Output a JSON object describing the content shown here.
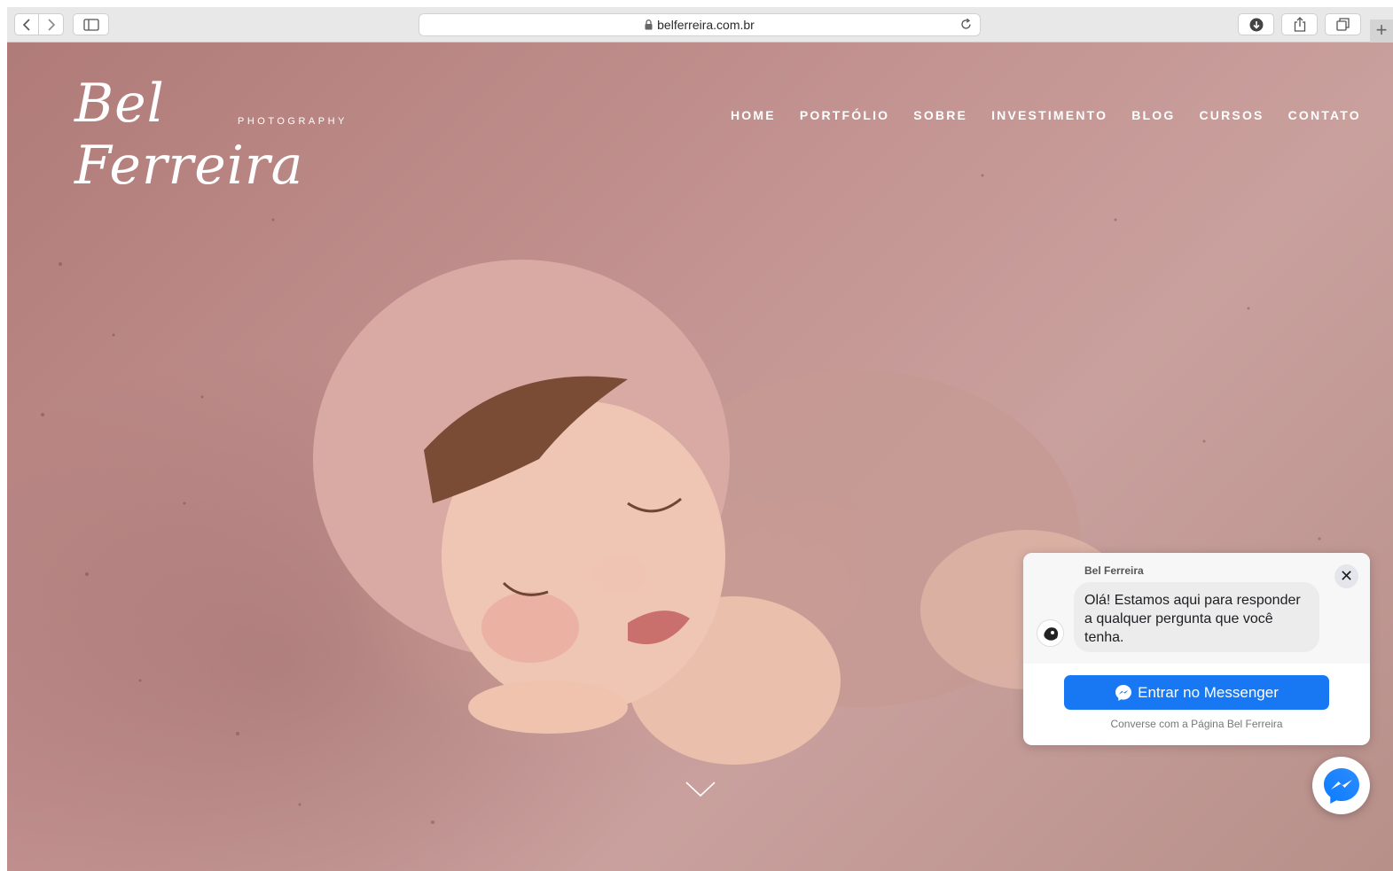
{
  "browser": {
    "url": "belferreira.com.br",
    "newtab_label": "+"
  },
  "site": {
    "logo_script": "Bel Ferreira",
    "logo_sub": "PHOTOGRAPHY",
    "nav": [
      "HOME",
      "PORTFÓLIO",
      "SOBRE",
      "INVESTIMENTO",
      "BLOG",
      "CURSOS",
      "CONTATO"
    ]
  },
  "chat": {
    "page_name": "Bel Ferreira",
    "message": "Olá! Estamos aqui para responder a qualquer pergunta que você tenha.",
    "close_label": "✕",
    "cta_label": "Entrar no Messenger",
    "footer": "Converse com a Página Bel Ferreira"
  },
  "colors": {
    "messenger_blue": "#1877f2",
    "chrome_gray": "#e8e8e8",
    "hero_pink": "#c29290"
  },
  "icons": {
    "back": "chevron-left-icon",
    "forward": "chevron-right-icon",
    "sidebar": "sidebar-icon",
    "lock": "lock-icon",
    "reload": "reload-icon",
    "download": "download-icon",
    "share": "share-icon",
    "tabs": "tabs-icon",
    "scroll": "chevron-down-icon",
    "messenger": "messenger-icon"
  }
}
